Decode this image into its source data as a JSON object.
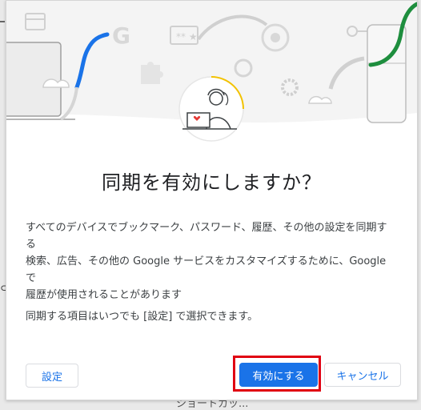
{
  "dialog": {
    "title": "同期を有効にしますか？",
    "description_lines": [
      "すべてのデバイスでブックマーク、パスワード、履歴、その他の設定を同期す",
      "る",
      "検索、広告、その他の Google サービスをカスタマイズするために、Google で",
      "履歴が使用されることがあります"
    ],
    "note": "同期する項目はいつでも [設定] で選択できます。",
    "buttons": {
      "settings": "設定",
      "enable": "有効にする",
      "cancel": "キャンセル"
    },
    "illustration_icons": [
      "google-g-icon",
      "chrome-icon",
      "key-icon",
      "puzzle-icon",
      "sync-icon",
      "gear-icon",
      "cloud-icon",
      "card-icon",
      "laptop-icon",
      "phone-icon",
      "user-avatar-icon"
    ]
  },
  "background": {
    "bottom_text": "ショートカッ..."
  },
  "colors": {
    "accent": "#1a73e8",
    "highlight": "#e00012",
    "green": "#1e8e3e"
  }
}
